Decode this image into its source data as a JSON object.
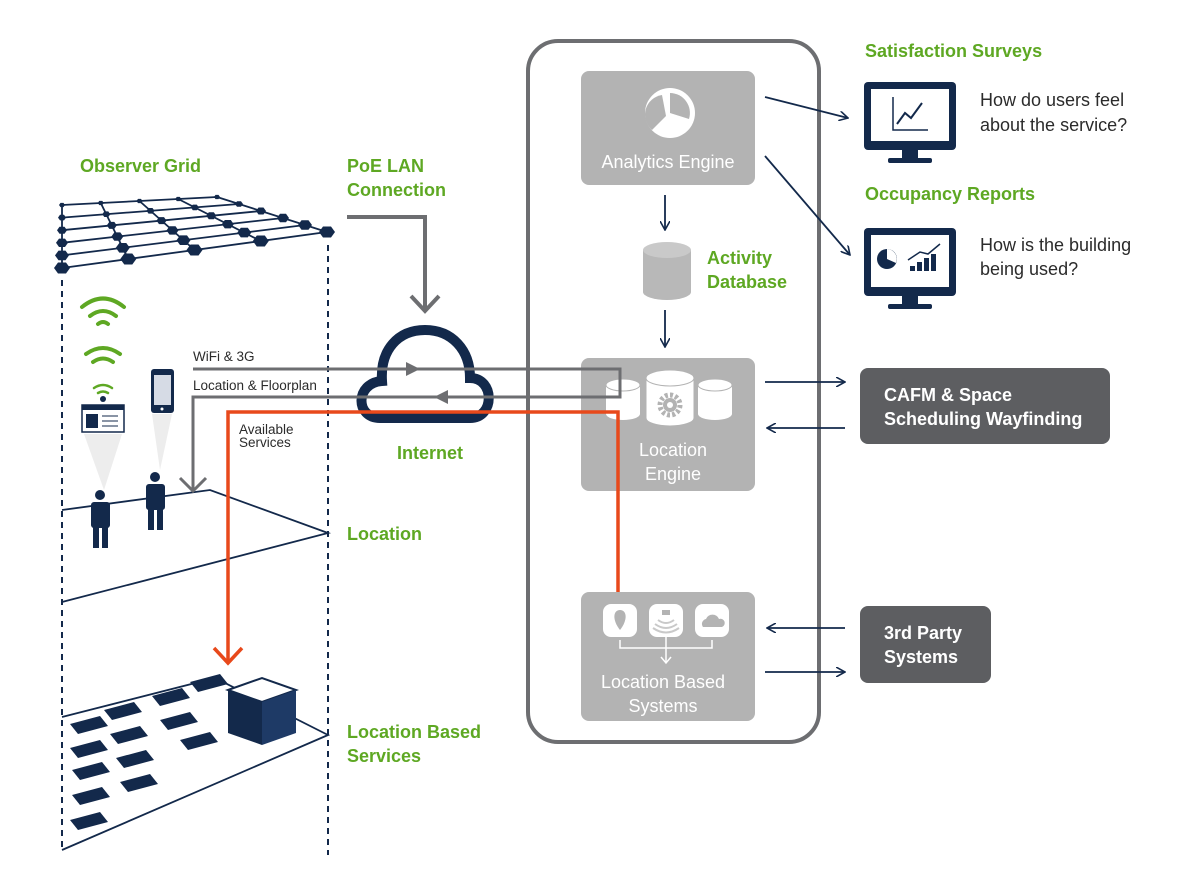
{
  "colors": {
    "accent_green": "#5ea823",
    "navy": "#13294b",
    "box_gray": "#b3b3b3",
    "dark_box": "#5d5e61",
    "orange": "#e8491b",
    "line_gray": "#6d6e71"
  },
  "left": {
    "observer_grid": "Observer Grid",
    "poe_lan": [
      "PoE LAN",
      "Connection"
    ],
    "internet": "Internet",
    "location": "Location",
    "location_based_services": [
      "Location Based",
      "Services"
    ],
    "wifi_3g": "WiFi & 3G",
    "location_floorplan": "Location & Floorplan",
    "available_services": [
      "Available",
      "Services"
    ]
  },
  "center": {
    "analytics_engine": "Analytics Engine",
    "activity_database": [
      "Activity",
      "Database"
    ],
    "location_engine": [
      "Location",
      "Engine"
    ],
    "location_based_systems": [
      "Location Based",
      "Systems"
    ]
  },
  "right": {
    "satisfaction_surveys": {
      "title": "Satisfaction Surveys",
      "text": [
        "How do users feel",
        "about the service?"
      ]
    },
    "occupancy_reports": {
      "title": "Occupancy Reports",
      "text": [
        "How is the building",
        "being used?"
      ]
    },
    "cafm": [
      "CAFM & Space",
      "Scheduling Wayfinding"
    ],
    "third_party": [
      "3rd Party",
      "Systems"
    ]
  },
  "icons": [
    "pie-chart-icon",
    "database-icon",
    "gear-icon",
    "location-pin-icon",
    "beacon-icon",
    "cloud-icon",
    "monitor-chart-icon",
    "monitor-report-icon",
    "wifi-icon",
    "badge-icon",
    "phone-icon",
    "person-icon",
    "internet-cloud-icon"
  ]
}
